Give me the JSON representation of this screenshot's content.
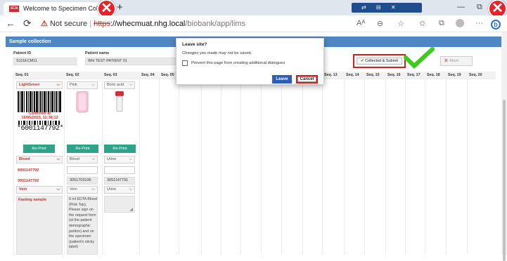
{
  "browser": {
    "tab_title": "Welcome to Specimen Collectio",
    "favicon_text": "SCN",
    "new_tab_symbol": "+",
    "url_warning": "Not secure",
    "url_scheme": "https",
    "url_domain": "://whecmuat.nhg.local",
    "url_path": "/biobank/app/lims",
    "read_aloud_label": "Aᴬ",
    "close_symbol": "✕",
    "minimize_symbol": "—",
    "restore_symbol": "⧉"
  },
  "app": {
    "header_title": "Sample collection",
    "patient_id_label": "Patient ID",
    "patient_id_value": "S111ECM11",
    "patient_name_label": "Patient name",
    "patient_name_value": "WH TEST PATIENT 01",
    "collect_button_label": "Collected & Submit",
    "abort_button_label": "Abort",
    "columns": [
      "Seq. 01",
      "Seq. 02",
      "Seq. 03",
      "Seq. 04",
      "Seq. 05",
      "Seq. 13",
      "Seq. 14",
      "Seq. 15",
      "Seq. 16",
      "Seq. 17",
      "Seq. 18",
      "Seq. 19",
      "Seq. 20"
    ],
    "tube_types": [
      "LightGreen",
      "Pink",
      "Boric acid"
    ],
    "barcode_collected_text": "Collected at",
    "barcode_datetime": "16/05/2023, 11:38:12",
    "barcode_number": "*6001147792*",
    "reprint_label": "Re-Print",
    "specimen_types": [
      "Blood",
      "Blood",
      "Urine"
    ],
    "lab_numbers": [
      "6001147792",
      "",
      ""
    ],
    "accession_numbers": [
      "3051147792",
      "3051703106",
      "3051147791"
    ],
    "sites": [
      "Vein",
      "Vein",
      "Urine"
    ],
    "notes": [
      "Fasting sample",
      "6 ml EDTA Blood (Pink Top), Please sign on the request form (at the patient demographic portion) and on the specimen (patient's sticky label)",
      ""
    ]
  },
  "dialog": {
    "title": "Leave site?",
    "message": "Changes you made may not be saved.",
    "checkbox_label": "Prevent this page from creating additional dialogues",
    "leave_label": "Leave",
    "cancel_label": "Cancel"
  },
  "colors": {
    "header_blue": "#4e87c3",
    "reprint_green": "#2ea38a",
    "annotation_red": "#d31f1f",
    "check_green": "#3ecb1c"
  }
}
